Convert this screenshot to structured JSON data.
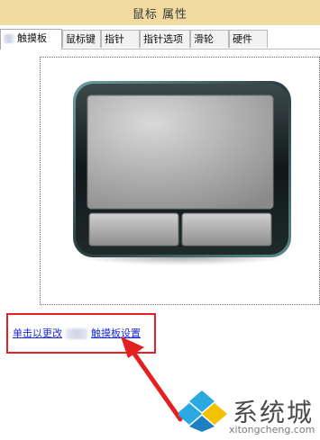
{
  "window": {
    "title": "鼠标 属性"
  },
  "tabs": [
    {
      "label": "触摸板",
      "active": true
    },
    {
      "label": "鼠标键"
    },
    {
      "label": "指针"
    },
    {
      "label": "指针选项"
    },
    {
      "label": "滑轮"
    },
    {
      "label": "硬件"
    }
  ],
  "link": {
    "prefix": "单击以更改",
    "suffix": "触摸板设置"
  },
  "icons": {
    "touchpad": "touchpad-icon",
    "arrow": "red-arrow-icon",
    "logo": "watermark-logo-icon"
  },
  "watermark": {
    "text": "系统城",
    "url": "xitongcheng.com"
  },
  "colors": {
    "titlebar": "#f0dca0",
    "link": "#1a2bd0",
    "highlight": "#e42020"
  }
}
